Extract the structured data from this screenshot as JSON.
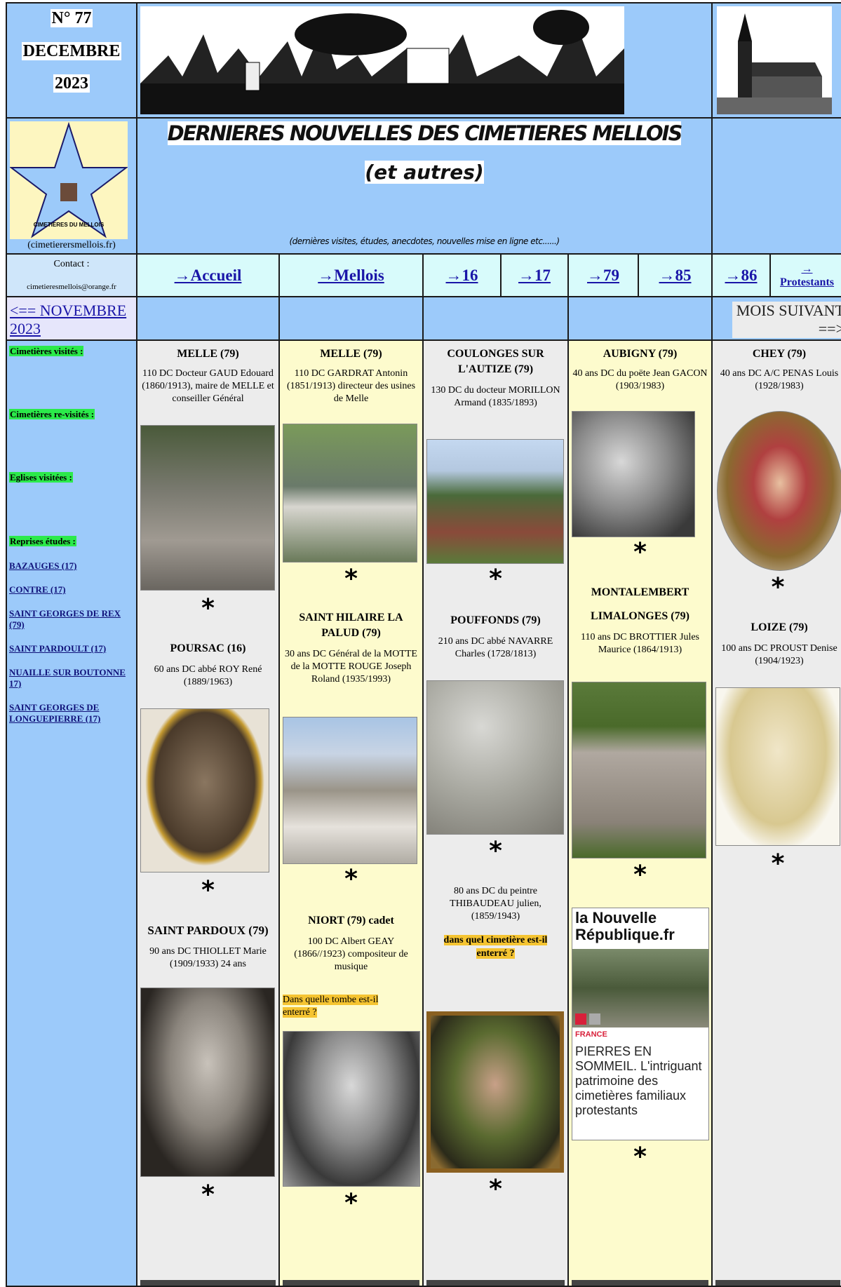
{
  "header": {
    "issue": "N° 77",
    "month": "DECEMBRE",
    "year": "2023",
    "site_title": "DERNIERES NOUVELLES DES CIMETIERES MELLOIS",
    "site_subtitle": "(et autres)",
    "tagline": "(dernières visites, études, anecdotes, nouvelles mise en ligne etc......)",
    "logo_caption": "(cimetierersmellois.fr)",
    "logo_text": "CIMETIERES DU MELLOIS"
  },
  "contact": {
    "label": "Contact :",
    "email": "cimetieresmellois@orange.fr"
  },
  "nav": {
    "accueil": "→Accueil",
    "mellois": "→Mellois",
    "d16": "→16",
    "d17": "→17",
    "d79": "→79",
    "d85": "→85",
    "d86": "→86",
    "protestants_arrow": "→",
    "protestants": "Protestants"
  },
  "pager": {
    "prev_line1": "<== NOVEMBRE",
    "prev_line2": "2023",
    "next_line1": "MOIS SUIVANT",
    "next_line2": "==>"
  },
  "sidebar": {
    "tag1": "Cimetières visités :",
    "tag2": "Cimetières re-visités :",
    "tag3": "Eglises visitées :",
    "tag4": "Reprises études :",
    "links": [
      "BAZAUGES (17)",
      "CONTRE (17)",
      "SAINT GEORGES DE REX (79)",
      "SAINT PARDOULT (17)",
      "NUAILLE SUR BOUTONNE 17)",
      "SAINT GEORGES DE LONGUEPIERRE (17)"
    ]
  },
  "col1": {
    "a_title": "MELLE (79)",
    "a_text": "110 DC Docteur GAUD Edouard (1860/1913), maire de MELLE et conseiller Général",
    "b_title": "POURSAC (16)",
    "b_text": "60 ans DC abbé ROY René (1889/1963)",
    "c_title": "SAINT PARDOUX (79)",
    "c_text": "90 ans DC THIOLLET Marie (1909/1933) 24 ans"
  },
  "col2": {
    "a_title": "MELLE (79)",
    "a_text": "110 DC GARDRAT Antonin (1851/1913) directeur des usines de Melle",
    "b_title": "SAINT HILAIRE LA PALUD (79)",
    "b_text": "30 ans DC Général de la MOTTE de la MOTTE ROUGE Joseph Roland (1935/1993)",
    "c_title": "NIORT (79) cadet",
    "c_text": "100 DC Albert GEAY (1866//1923) compositeur de musique",
    "c_highlight": "Dans quelle tombe est-il enterré ?"
  },
  "col3": {
    "a_title": "COULONGES SUR L'AUTIZE (79)",
    "a_text": "130 DC du docteur MORILLON Armand (1835/1893)",
    "b_title": "POUFFONDS (79)",
    "b_text": "210 ans DC abbé NAVARRE Charles (1728/1813)",
    "c_text": "80 ans DC du peintre THIBAUDEAU julien, (1859/1943)",
    "c_highlight": "dans quel cimetière est-il enterré ?"
  },
  "col4": {
    "a_title": "AUBIGNY (79)",
    "a_text": "40 ans DC du poëte Jean GACON (1903/1983)",
    "b_title1": "MONTALEMBERT",
    "b_title2": "LIMALONGES (79)",
    "b_text": "110 ans DC BROTTIER Jules Maurice (1864/1913)",
    "news_brand1": "la Nouvelle",
    "news_brand2": "République.fr",
    "news_tag": "FRANCE",
    "news_headline": "PIERRES EN SOMMEIL. L'intriguant patrimoine des cimetières familiaux protestants"
  },
  "col5": {
    "a_title": "CHEY (79)",
    "a_text": "40 ans DC A/C PENAS Louis (1928/1983)",
    "b_title": "LOIZE (79)",
    "b_text": "100 ans DC PROUST Denise (1904/1923)"
  },
  "star": "*",
  "colors": {
    "page_blue": "#9ccafa",
    "nav_cyan": "#d8fbfb",
    "col_yellow": "#fdfbcd",
    "col_grey": "#ececec",
    "tag_green": "#2bea4a",
    "highlight": "#f5c431",
    "link": "#1a16a8"
  }
}
